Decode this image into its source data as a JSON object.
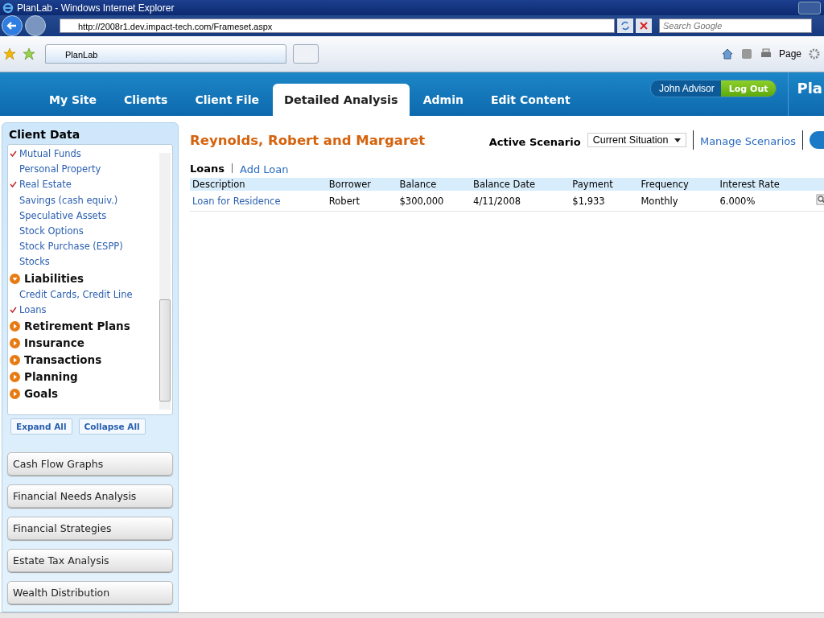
{
  "browser": {
    "title": "PlanLab - Windows Internet Explorer",
    "address": "http://2008r1.dev.impact-tech.com/Frameset.aspx",
    "search": {
      "placeholder": "Search Google"
    },
    "tab": "PlanLab",
    "page_menu": "Page"
  },
  "nav": {
    "tabs": [
      {
        "label": "My Site",
        "selected": false
      },
      {
        "label": "Clients",
        "selected": false
      },
      {
        "label": "Client File",
        "selected": false
      },
      {
        "label": "Detailed Analysis",
        "selected": true
      },
      {
        "label": "Admin",
        "selected": false
      },
      {
        "label": "Edit Content",
        "selected": false
      }
    ],
    "user": "John Advisor",
    "logout": "Log Out",
    "brand": "Pla"
  },
  "sidebar": {
    "title": "Client Data",
    "tree": [
      {
        "kind": "leaf",
        "label": "Mutual Funds",
        "checked": true
      },
      {
        "kind": "leaf",
        "label": "Personal Property",
        "checked": false
      },
      {
        "kind": "leaf",
        "label": "Real Estate",
        "checked": true
      },
      {
        "kind": "leaf",
        "label": "Savings (cash equiv.)",
        "checked": false
      },
      {
        "kind": "leaf",
        "label": "Speculative Assets",
        "checked": false
      },
      {
        "kind": "leaf",
        "label": "Stock Options",
        "checked": false
      },
      {
        "kind": "leaf",
        "label": "Stock Purchase (ESPP)",
        "checked": false
      },
      {
        "kind": "leaf",
        "label": "Stocks",
        "checked": false
      },
      {
        "kind": "group",
        "label": "Liabilities",
        "expanded": true,
        "children": [
          {
            "kind": "leaf",
            "label": "Credit Cards, Credit Line",
            "checked": false
          },
          {
            "kind": "leaf",
            "label": "Loans",
            "checked": true
          }
        ]
      },
      {
        "kind": "group",
        "label": "Retirement Plans",
        "expanded": false
      },
      {
        "kind": "group",
        "label": "Insurance",
        "expanded": false
      },
      {
        "kind": "group",
        "label": "Transactions",
        "expanded": false
      },
      {
        "kind": "group",
        "label": "Planning",
        "expanded": false
      },
      {
        "kind": "group",
        "label": "Goals",
        "expanded": false
      }
    ],
    "tree_buttons": [
      "Expand All",
      "Collapse All"
    ],
    "buttons": [
      "Cash Flow Graphs",
      "Financial Needs Analysis",
      "Financial Strategies",
      "Estate Tax Analysis",
      "Wealth Distribution"
    ]
  },
  "main": {
    "client": "Reynolds, Robert and Margaret",
    "scenario_label": "Active Scenario",
    "scenario": "Current Situation",
    "manage": "Manage Scenarios",
    "section": "Loans",
    "add": "Add Loan",
    "table": {
      "columns": [
        "Description",
        "Borrower",
        "Balance",
        "Balance Date",
        "Payment",
        "Frequency",
        "Interest Rate"
      ],
      "rows": [
        {
          "cells": [
            "Loan for Residence",
            "Robert",
            "$300,000",
            "4/11/2008",
            "$1,933",
            "Monthly",
            "6.000%"
          ]
        }
      ]
    }
  }
}
